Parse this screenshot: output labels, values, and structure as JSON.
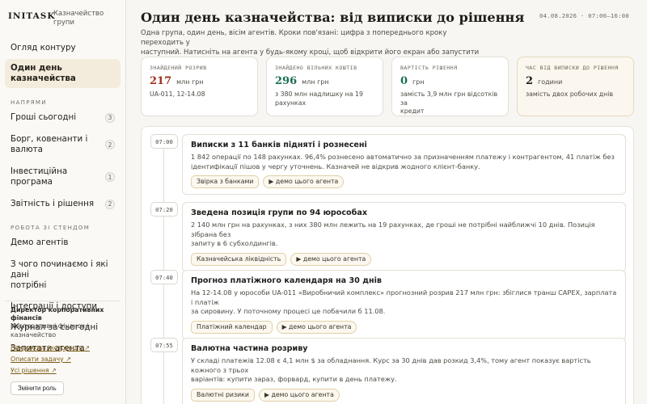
{
  "brand": {
    "logo": "INITASK",
    "subtitle_line1": "Казначейство",
    "subtitle_line2": "групи"
  },
  "sidebar": {
    "top_items": [
      {
        "label": "Огляд контуру"
      },
      {
        "label": "Один день казначейства"
      }
    ],
    "section1_title": "НАПРЯМИ",
    "directions": [
      {
        "label": "Гроші сьогодні",
        "count": "3"
      },
      {
        "label": "Борг, ковенанти і валюта",
        "count": "2"
      },
      {
        "label": "Інвестиційна програма",
        "count": "1"
      },
      {
        "label": "Звітність і рішення",
        "count": "2"
      }
    ],
    "section2_title": "РОБОТА ЗІ СТЕНДОМ",
    "stand_items": [
      {
        "label": "Демо агентів"
      },
      {
        "label_line1": "З чого починаємо і які дані",
        "label_line2": "потрібні"
      },
      {
        "label": "Інтеграції і доступи"
      },
      {
        "label": "Журнал за сьогодні"
      },
      {
        "label": "Запитати агента"
      }
    ],
    "footer": {
      "role_line1": "Директор корпоративних",
      "role_line2": "фінансів",
      "dept_line1": "Корпоративні фінанси і",
      "dept_line2": "казначейство",
      "links": [
        "Покрокова інструкція ↗",
        "Описати задачу ↗",
        "Усі рішення ↗"
      ],
      "role_button": "Змінити роль"
    }
  },
  "header": {
    "title": "Один день казначейства: від виписки до рішення",
    "datetime": "04.08.2026 · 07:00–16:00",
    "intro_line1": "Одна група, один день, вісім агентів. Кроки пов'язані: цифра з попереднього кроку переходить у",
    "intro_line2": "наступний. Натисніть на агента у будь-якому кроці, щоб відкрити його екран або запустити демо."
  },
  "stats": [
    {
      "label": "ЗНАЙДЕНИЙ РОЗРИВ",
      "value": "217",
      "unit": "млн грн",
      "color": "#a2321e",
      "note_line1": "UA-011, 12-14.08",
      "note_line2": ""
    },
    {
      "label": "ЗНАЙДЕНО ВІЛЬНИХ КОШТІВ",
      "value": "296",
      "unit": "млн грн",
      "color": "#1e6f4e",
      "note_line1": "з 380 млн надлишку на 19",
      "note_line2": "рахунках"
    },
    {
      "label": "ВАРТІСТЬ РІШЕННЯ",
      "value": "0",
      "unit": "грн",
      "color": "#1e6f4e",
      "note_line1": "замість 3,9 млн грн відсотків за",
      "note_line2": "кредит"
    },
    {
      "label": "ЧАС ВІД ВИПИСКИ ДО РІШЕННЯ",
      "value": "2",
      "unit": "години",
      "color": "#1f1d1a",
      "note_line1": "замість двох робочих днів",
      "note_line2": ""
    }
  ],
  "timeline": [
    {
      "time": "07:00",
      "title": "Виписки з 11 банків підняті і рознесені",
      "desc_line1": "1 842 операції по 148 рахунках. 96,4% рознесено автоматично за призначенням платежу і контрагентом, 41 платіж без",
      "desc_line2": "ідентифікації пішов у чергу уточнень. Казначей не відкрив жодного клієнт-банку.",
      "agent": "Звірка з банками",
      "demo": "▶ демо цього агента"
    },
    {
      "time": "07:20",
      "title": "Зведена позиція групи по 94 юрособах",
      "desc_line1": "2 140 млн грн на рахунках, з них 380 млн лежить на 19 рахунках, де гроші не потрібні найближчі 10 днів. Позиція зібрана без",
      "desc_line2": "запиту в 6 субхолдингів.",
      "agent": "Казначейська ліквідність",
      "demo": "▶ демо цього агента"
    },
    {
      "time": "07:40",
      "title": "Прогноз платіжного календаря на 30 днів",
      "desc_line1": "На 12-14.08 у юрособи UA-011 «Виробничий комплекс» прогнозний розрив 217 млн грн: збіглися транш CAPEX, зарплата і платіж",
      "desc_line2": "за сировину. У поточному процесі це побачили б 11.08.",
      "agent": "Платіжний календар",
      "demo": "▶ демо цього агента"
    },
    {
      "time": "07:55",
      "title": "Валютна частина розриву",
      "desc_line1": "У складі платежів 12.08 є 4,1 млн $ за обладнання. Курс за 30 днів дав розкид 3,4%, тому агент показує вартість кожного з трьох",
      "desc_line2": "варіантів: купити зараз, форвард, купити в день платежу.",
      "agent": "Валютні ризики",
      "demo": "▶ демо цього агента"
    }
  ]
}
